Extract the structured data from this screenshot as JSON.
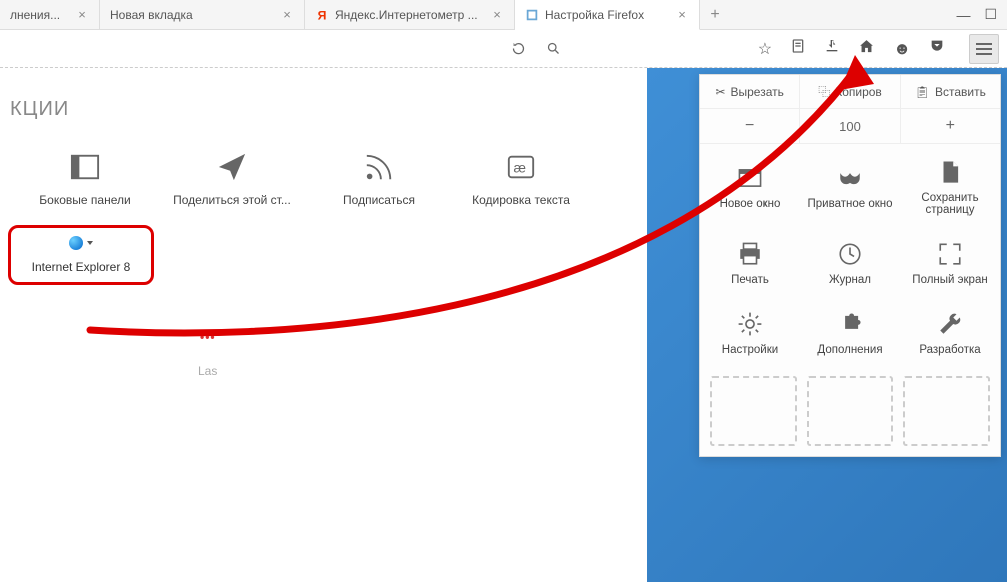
{
  "tabs": {
    "items": [
      {
        "label": "лнения..."
      },
      {
        "label": "Новая вкладка"
      },
      {
        "label": "Яндекс.Интернетометр ..."
      },
      {
        "label": "Настройка Firefox"
      }
    ]
  },
  "urlbar": {
    "search_icon": "search-icon"
  },
  "toolbar_icons": {
    "bookmark": "☆",
    "reader": "clipboard",
    "download": "↓",
    "home": "home",
    "hello": "☻",
    "pocket": "pocket"
  },
  "customize": {
    "section_title": "КЦИИ",
    "items": [
      {
        "label": "Боковые панели"
      },
      {
        "label": "Поделиться этой ст..."
      },
      {
        "label": "Подписаться"
      },
      {
        "label": "Кодировка текста"
      }
    ],
    "highlighted": {
      "label": "Internet Explorer 8"
    },
    "last_label": "Las"
  },
  "menu": {
    "edit": {
      "cut": "Вырезать",
      "copy": "Копиров",
      "paste": "Вставить"
    },
    "zoom": {
      "value": "100"
    },
    "grid": [
      {
        "label": "Новое оҝно"
      },
      {
        "label": "Приватное окно"
      },
      {
        "label": "Сохранить страницу"
      },
      {
        "label": "Печать"
      },
      {
        "label": "Журнал"
      },
      {
        "label": "Полный экран"
      },
      {
        "label": "Настройки"
      },
      {
        "label": "Дополнения"
      },
      {
        "label": "Разработка"
      }
    ]
  }
}
